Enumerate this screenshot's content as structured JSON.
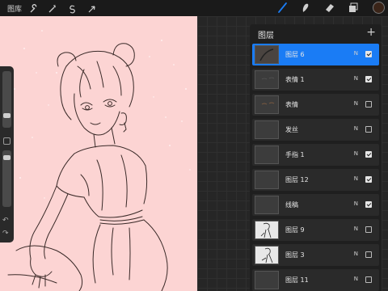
{
  "topbar": {
    "gallery_label": "图库",
    "left_tools": [
      "wrench-icon",
      "magic-wand-icon",
      "selection-s-icon",
      "transform-arrow-icon"
    ],
    "right_tools": [
      "brush-icon",
      "smudge-icon",
      "eraser-icon",
      "layers-icon"
    ],
    "current_color": "#3a2418",
    "active_tool_color": "#1a7cf5"
  },
  "canvas": {
    "background": "#fcd4d3"
  },
  "sidebar": {
    "undo_icon": "↶",
    "redo_icon": "↷"
  },
  "layers_panel": {
    "title": "图层",
    "add_label": "+",
    "layers": [
      {
        "name": "图层 6",
        "blend": "N",
        "visible": true,
        "active": true
      },
      {
        "name": "表情 1",
        "blend": "N",
        "visible": true,
        "active": false
      },
      {
        "name": "表情",
        "blend": "N",
        "visible": false,
        "active": false
      },
      {
        "name": "发丝",
        "blend": "N",
        "visible": false,
        "active": false
      },
      {
        "name": "手指 1",
        "blend": "N",
        "visible": true,
        "active": false
      },
      {
        "name": "图层 12",
        "blend": "N",
        "visible": true,
        "active": false
      },
      {
        "name": "线稿",
        "blend": "N",
        "visible": true,
        "active": false
      },
      {
        "name": "图层 9",
        "blend": "N",
        "visible": false,
        "active": false
      },
      {
        "name": "图层 3",
        "blend": "N",
        "visible": false,
        "active": false
      },
      {
        "name": "图层 11",
        "blend": "N",
        "visible": false,
        "active": false
      }
    ]
  }
}
